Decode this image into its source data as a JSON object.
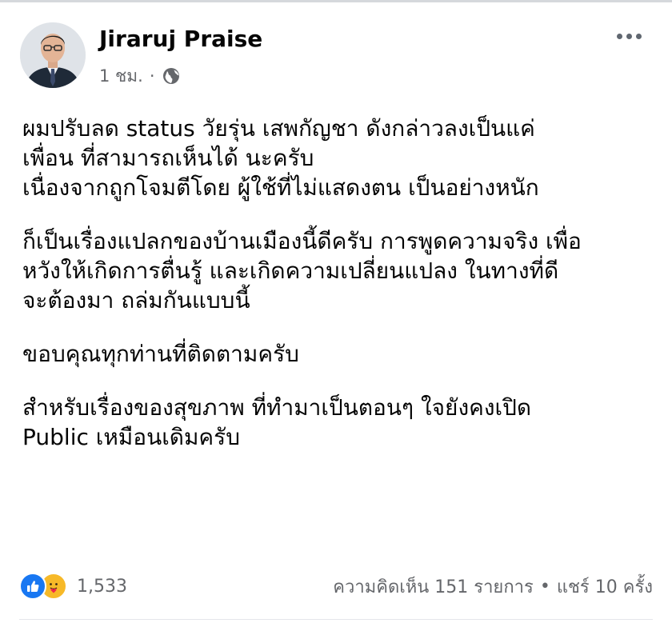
{
  "post": {
    "author": "Jiraruj Praise",
    "timestamp": "1 ชม.",
    "meta_separator": "·",
    "privacy_icon": "globe-icon",
    "more_icon": "more-options-icon",
    "paragraphs": [
      {
        "lines": [
          "ผมปรับลด status วัยรุ่น เสพกัญชา ดังกล่าวลงเป็นแค่",
          "เพื่อน ที่สามารถเห็นได้ นะครับ",
          "เนื่องจากถูกโจมตีโดย ผู้ใช้ที่ไม่แสดงตน เป็นอย่างหนัก"
        ]
      },
      {
        "lines": [
          "ก็เป็นเรื่องแปลกของบ้านเมืองนี้ดีครับ การพูดความจริง เพื่อ",
          "หวังให้เกิดการตื่นรู้ และเกิดความเปลี่ยนแปลง ในทางที่ดี",
          "จะต้องมา ถล่มกันแบบนี้"
        ]
      },
      {
        "lines": [
          "ขอบคุณทุกท่านที่ติดตามครับ"
        ]
      },
      {
        "lines": [
          "สำหรับเรื่องของสุขภาพ ที่ทำมาเป็นตอนๆ ใจยังคงเปิด",
          "Public เหมือนเดิมครับ"
        ]
      }
    ]
  },
  "reactions": {
    "icons": [
      "like-icon",
      "care-icon"
    ],
    "count": "1,533",
    "colors": {
      "like": "#1877f2",
      "care": "#f7b928"
    }
  },
  "stats": {
    "comments": "ความคิดเห็น 151 รายการ",
    "separator": "•",
    "shares": "แชร์ 10 ครั้ง"
  },
  "colors": {
    "text_primary": "#050505",
    "text_secondary": "#65676b",
    "background": "#ffffff"
  }
}
